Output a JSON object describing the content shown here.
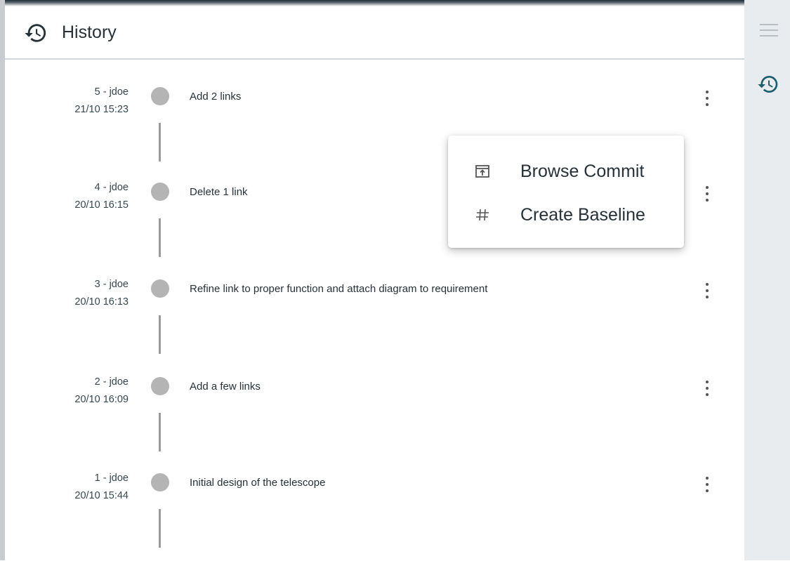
{
  "panel": {
    "title": "History",
    "header_icon": "history-icon"
  },
  "rail": {
    "menu_icon": "hamburger-menu-icon",
    "history_icon": "history-icon",
    "accent_color": "#1a5f6e"
  },
  "commits": [
    {
      "id_user": "5 - jdoe",
      "date": "21/10 15:23",
      "message": "Add 2 links"
    },
    {
      "id_user": "4 - jdoe",
      "date": "20/10 16:15",
      "message": "Delete 1 link"
    },
    {
      "id_user": "3 - jdoe",
      "date": "20/10 16:13",
      "message": "Refine link to proper function and attach diagram to requirement"
    },
    {
      "id_user": "2 - jdoe",
      "date": "20/10 16:09",
      "message": "Add a few links"
    },
    {
      "id_user": "1 - jdoe",
      "date": "20/10 15:44",
      "message": "Initial design of the telescope"
    }
  ],
  "context_menu": {
    "items": [
      {
        "label": "Browse Commit",
        "icon": "browse-commit-icon"
      },
      {
        "label": "Create Baseline",
        "icon": "hash-icon"
      }
    ]
  }
}
